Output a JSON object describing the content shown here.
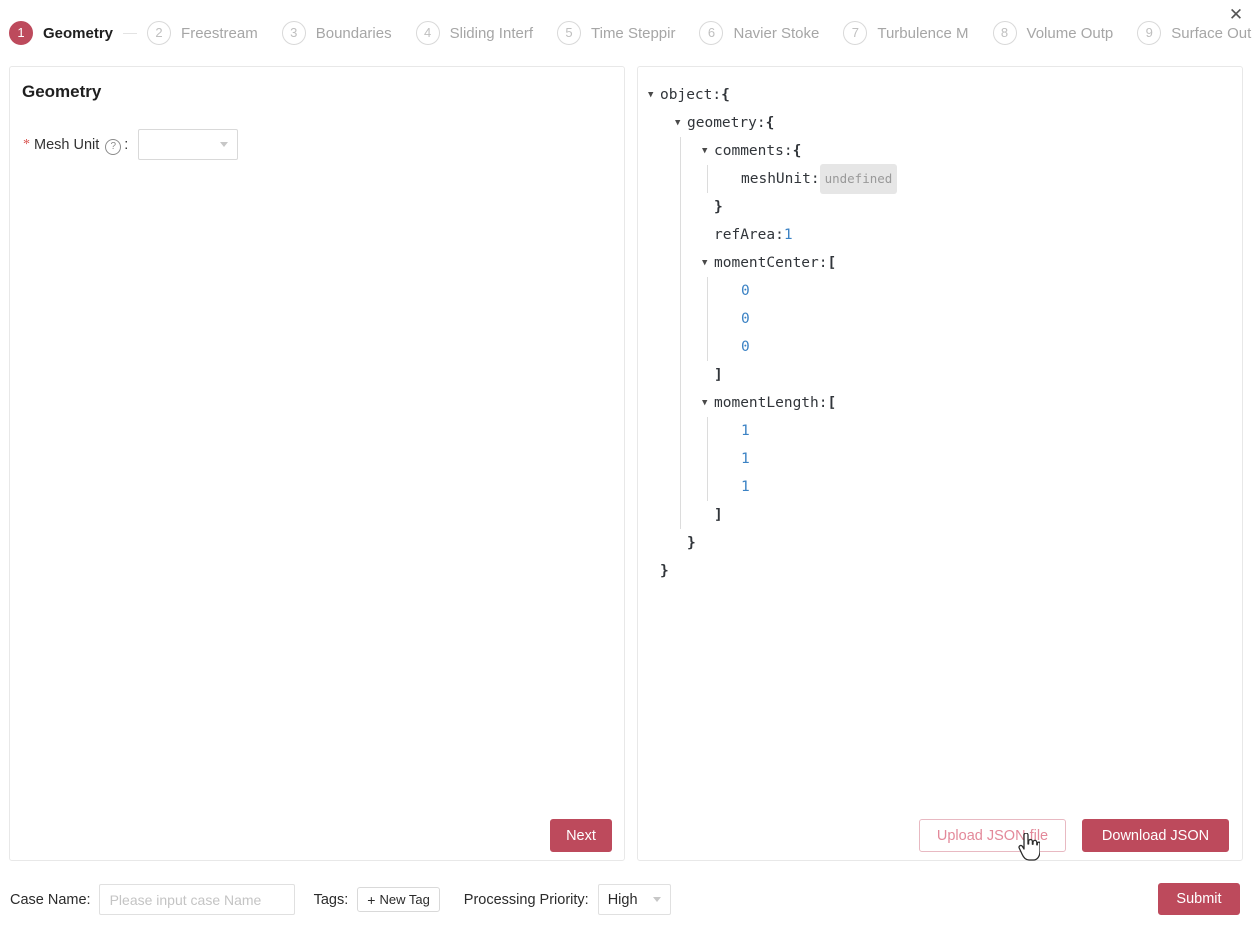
{
  "window": {
    "close_icon": "close-icon",
    "close_glyph": "✕"
  },
  "steps": [
    {
      "number": "1",
      "label": "Geometry",
      "active": true
    },
    {
      "number": "2",
      "label": "Freestream",
      "active": false
    },
    {
      "number": "3",
      "label": "Boundaries",
      "active": false
    },
    {
      "number": "4",
      "label": "Sliding Interf",
      "active": false
    },
    {
      "number": "5",
      "label": "Time Steppir",
      "active": false
    },
    {
      "number": "6",
      "label": "Navier Stoke",
      "active": false
    },
    {
      "number": "7",
      "label": "Turbulence M",
      "active": false
    },
    {
      "number": "8",
      "label": "Volume Outp",
      "active": false
    },
    {
      "number": "9",
      "label": "Surface Output",
      "active": false
    }
  ],
  "left_panel": {
    "title": "Geometry",
    "mesh_unit": {
      "required_mark": "*",
      "label": "Mesh Unit",
      "help_icon": "help-icon",
      "help_glyph": "?",
      "colon": ":",
      "value": "",
      "chevron_icon": "chevron-down-icon"
    },
    "next_label": "Next"
  },
  "right_panel": {
    "upload_label": "Upload JSON file",
    "download_label": "Download JSON",
    "tree": [
      {
        "depth": 0,
        "guides": 0,
        "triangle": "▼",
        "key": "object",
        "sep": " : ",
        "punc": "{",
        "type": "open"
      },
      {
        "depth": 1,
        "guides": 1,
        "triangle": "▼",
        "key": "geometry",
        "sep": " : ",
        "punc": "{",
        "type": "open"
      },
      {
        "depth": 2,
        "guides": 2,
        "triangle": "▼",
        "key": "comments",
        "sep": " : ",
        "punc": "{",
        "type": "open"
      },
      {
        "depth": 3,
        "guides": 3,
        "triangle": "",
        "key": "meshUnit",
        "sep": " : ",
        "value": "undefined",
        "type": "undefined"
      },
      {
        "depth": 2,
        "guides": 2,
        "triangle": "",
        "punc": "}",
        "type": "close"
      },
      {
        "depth": 2,
        "guides": 2,
        "triangle": "",
        "key": "refArea",
        "sep": " : ",
        "value": "1",
        "type": "number"
      },
      {
        "depth": 2,
        "guides": 2,
        "triangle": "▼",
        "key": "momentCenter",
        "sep": " : ",
        "punc": "[",
        "type": "open"
      },
      {
        "depth": 3,
        "guides": 3,
        "triangle": "",
        "value": "0",
        "type": "number"
      },
      {
        "depth": 3,
        "guides": 3,
        "triangle": "",
        "value": "0",
        "type": "number"
      },
      {
        "depth": 3,
        "guides": 3,
        "triangle": "",
        "value": "0",
        "type": "number"
      },
      {
        "depth": 2,
        "guides": 2,
        "triangle": "",
        "punc": "]",
        "type": "close"
      },
      {
        "depth": 2,
        "guides": 2,
        "triangle": "▼",
        "key": "momentLength",
        "sep": " : ",
        "punc": "[",
        "type": "open"
      },
      {
        "depth": 3,
        "guides": 3,
        "triangle": "",
        "value": "1",
        "type": "number"
      },
      {
        "depth": 3,
        "guides": 3,
        "triangle": "",
        "value": "1",
        "type": "number"
      },
      {
        "depth": 3,
        "guides": 3,
        "triangle": "",
        "value": "1",
        "type": "number"
      },
      {
        "depth": 2,
        "guides": 2,
        "triangle": "",
        "punc": "]",
        "type": "close"
      },
      {
        "depth": 1,
        "guides": 1,
        "triangle": "",
        "punc": "}",
        "type": "close"
      },
      {
        "depth": 0,
        "guides": 0,
        "triangle": "",
        "punc": "}",
        "type": "close"
      }
    ]
  },
  "bottom_bar": {
    "case_name_label": "Case Name:",
    "case_name_value": "",
    "case_name_placeholder": "Please input case Name",
    "tags_label": "Tags:",
    "new_tag_label": "New Tag",
    "new_tag_plus": "+",
    "priority_label": "Processing Priority:",
    "priority_value": "High",
    "priority_chevron_icon": "chevron-down-icon",
    "submit_label": "Submit"
  },
  "colors": {
    "accent": "#bd4a5c",
    "accent_light": "#e3899a",
    "json_number": "#3b82c4",
    "undefined_badge": "#e6e6e6"
  }
}
